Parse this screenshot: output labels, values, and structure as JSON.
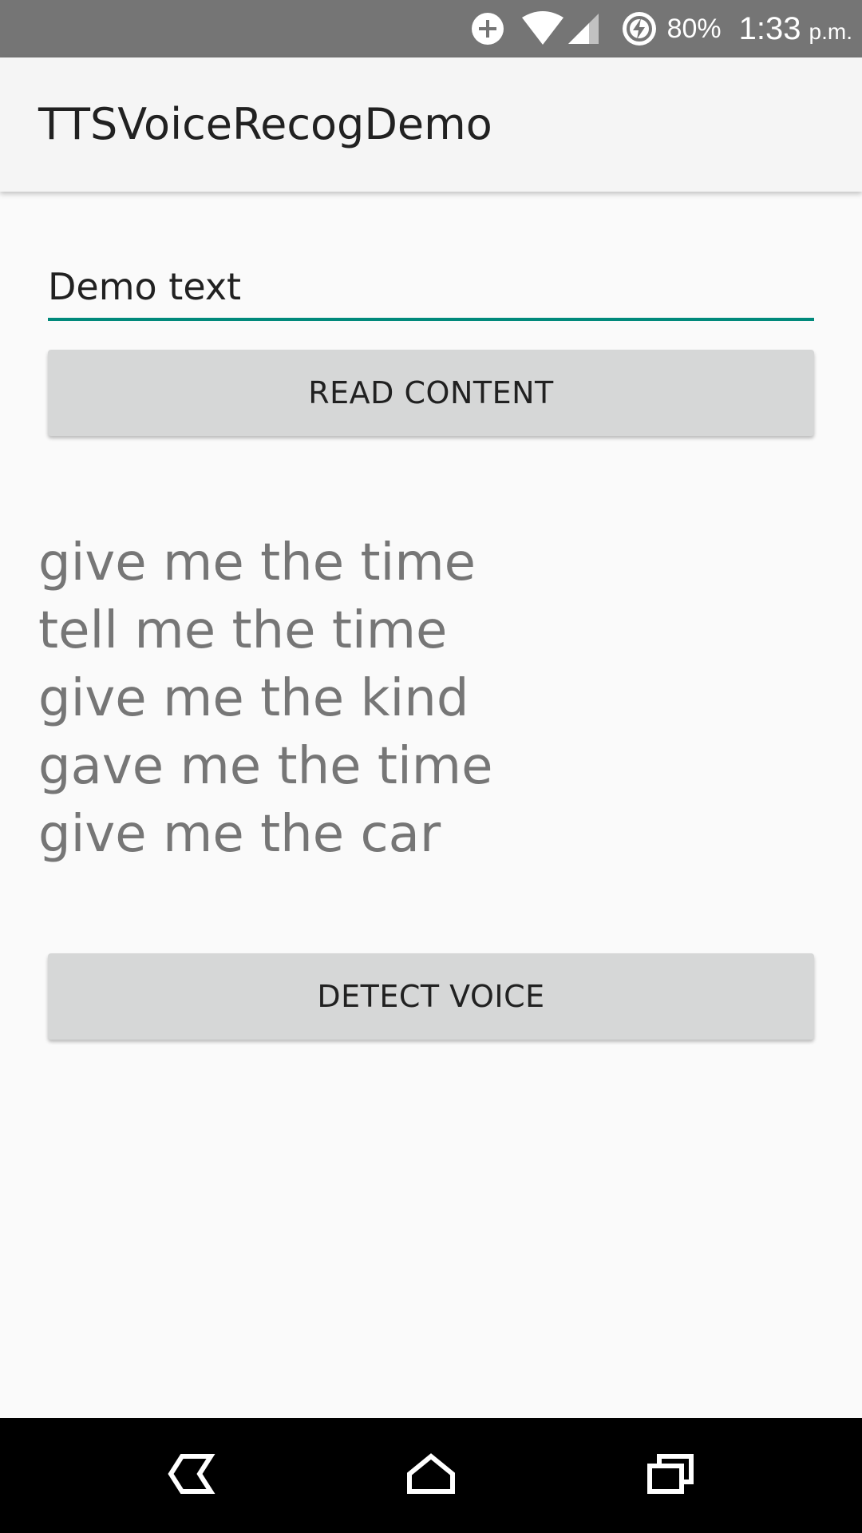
{
  "status_bar": {
    "icons": [
      "data-saver-icon",
      "wifi-icon",
      "cell-signal-icon",
      "battery-charging-icon"
    ],
    "battery": "80%",
    "time": "1:33",
    "ampm": "p.m."
  },
  "app_bar": {
    "title": "TTSVoiceRecogDemo"
  },
  "main": {
    "text_field": {
      "value": "Demo text"
    },
    "read_button_label": "READ CONTENT",
    "results": [
      "give me the time",
      "tell me the time",
      "give me the kind",
      "gave me the time",
      "give me the car"
    ],
    "detect_button_label": "DETECT VOICE"
  },
  "nav_bar": {
    "icons": [
      "back-icon",
      "home-icon",
      "recents-icon"
    ]
  },
  "colors": {
    "status_bar": "#757575",
    "app_bar": "#f5f5f5",
    "background": "#fafafa",
    "accent": "#00897b",
    "button": "#d6d7d7",
    "result_text": "#767676"
  }
}
